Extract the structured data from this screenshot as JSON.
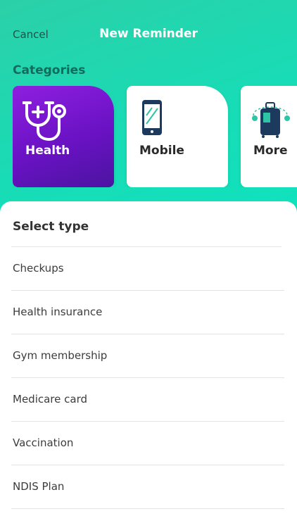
{
  "header": {
    "cancel_label": "Cancel",
    "title": "New Reminder",
    "categories_label": "Categories"
  },
  "categories": [
    {
      "label": "Health",
      "icon": "stethoscope-icon",
      "selected": true
    },
    {
      "label": "Mobile",
      "icon": "mobile-phone-icon",
      "selected": false
    },
    {
      "label": "More",
      "icon": "luggage-icon",
      "selected": false
    }
  ],
  "sheet": {
    "title": "Select type",
    "types": [
      {
        "label": "Checkups"
      },
      {
        "label": "Health insurance"
      },
      {
        "label": "Gym membership"
      },
      {
        "label": "Medicare card"
      },
      {
        "label": "Vaccination"
      },
      {
        "label": "NDIS Plan"
      }
    ]
  },
  "colors": {
    "header_gradient_start": "#2bd0a8",
    "header_gradient_end": "#0ee3bf",
    "selected_card_start": "#8e1fe0",
    "selected_card_end": "#4b14a0",
    "categories_label": "#146a5c",
    "icon_navy": "#1c3a5e",
    "icon_teal": "#2ec4a6"
  }
}
